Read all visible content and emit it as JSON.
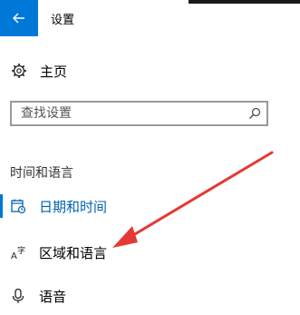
{
  "header": {
    "title": "设置",
    "back_icon": "arrow-left-icon",
    "accent": "#0078d7"
  },
  "home": {
    "label": "主页",
    "icon": "gear-icon"
  },
  "search": {
    "placeholder": "查找设置",
    "value": "",
    "icon": "search-icon"
  },
  "section": {
    "title": "时间和语言"
  },
  "nav": [
    {
      "label": "日期和时间",
      "icon": "calendar-clock-icon",
      "active": true
    },
    {
      "label": "区域和语言",
      "icon": "region-language-icon",
      "active": false
    },
    {
      "label": "语音",
      "icon": "microphone-icon",
      "active": false
    }
  ],
  "annotation": {
    "color": "#e53935"
  }
}
